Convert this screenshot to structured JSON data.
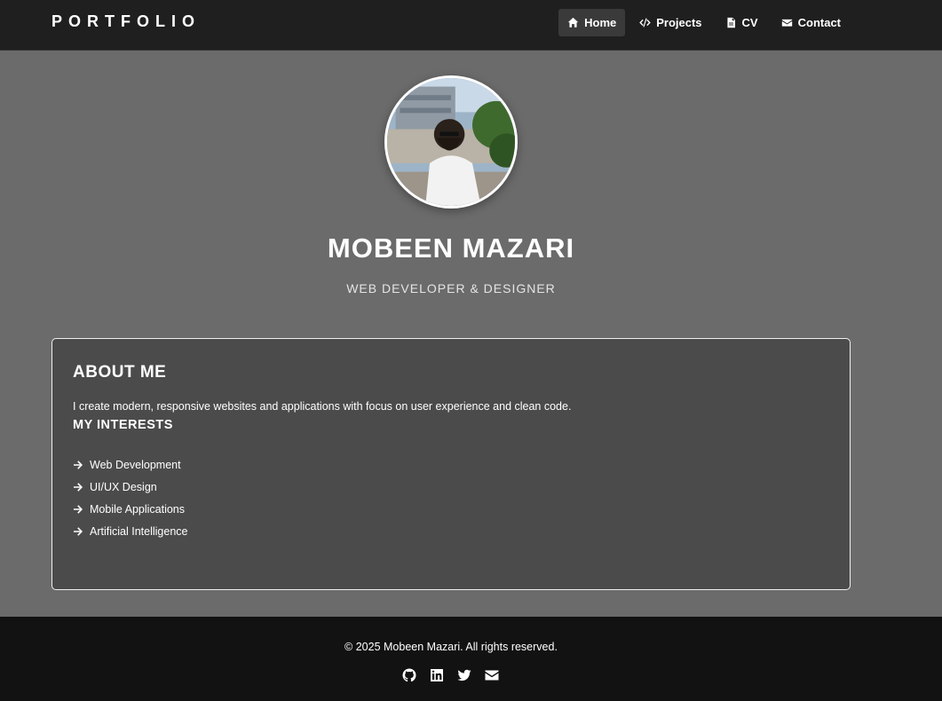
{
  "navbar": {
    "brand": "PORTFOLIO",
    "links": [
      {
        "label": "Home",
        "icon": "home-icon",
        "active": true
      },
      {
        "label": "Projects",
        "icon": "code-icon"
      },
      {
        "label": "CV",
        "icon": "file-icon"
      },
      {
        "label": "Contact",
        "icon": "envelope-icon"
      }
    ]
  },
  "hero": {
    "name": "MOBEEN MAZARI",
    "title": "WEB DEVELOPER & DESIGNER"
  },
  "about": {
    "heading": "ABOUT ME",
    "text": "I create modern, responsive websites and applications with focus on user experience and clean code.",
    "interests_heading": "MY INTERESTS",
    "interests": [
      "Web Development",
      "UI/UX Design",
      "Mobile Applications",
      "Artificial Intelligence"
    ]
  },
  "footer": {
    "copyright": "© 2025 Mobeen Mazari. All rights reserved.",
    "socials": [
      "github-icon",
      "linkedin-icon",
      "twitter-icon",
      "envelope-icon"
    ]
  },
  "colors": {
    "navbar_bg": "#1f1f1f",
    "page_bg": "#6b6b6b",
    "card_bg": "#4b4b4b",
    "footer_bg": "#121212",
    "text": "#ffffff"
  }
}
